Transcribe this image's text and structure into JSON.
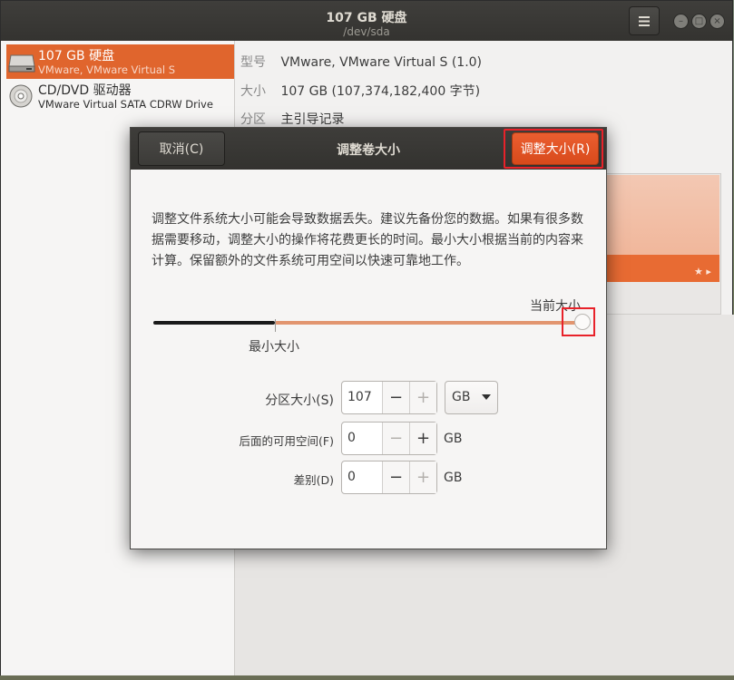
{
  "window": {
    "title": "107 GB 硬盘",
    "subtitle": "/dev/sda"
  },
  "sidebar": {
    "items": [
      {
        "name": "107 GB 硬盘",
        "sub": "VMware, VMware Virtual S",
        "icon": "hard-disk-icon",
        "selected": true
      },
      {
        "name": "CD/DVD 驱动器",
        "sub": "VMware Virtual SATA CDRW Drive",
        "icon": "optical-disc-icon",
        "selected": false
      }
    ]
  },
  "info": {
    "model_key": "型号",
    "model_val": "VMware, VMware Virtual S (1.0)",
    "size_key": "大小",
    "size_val": "107 GB (107,374,182,400 字节)",
    "partition_key": "分区",
    "partition_val": "主引导记录"
  },
  "dialog": {
    "title": "调整卷大小",
    "cancel_label": "取消(C)",
    "resize_label": "调整大小(R)",
    "warning": "调整文件系统大小可能会导致数据丢失。建议先备份您的数据。如果有很多数据需要移动，调整大小的操作将花费更长的时间。最小大小根据当前的内容来计算。保留额外的文件系统可用空间以快速可靠地工作。",
    "current_size_label": "当前大小",
    "min_size_label": "最小大小",
    "slider_level": 1.0,
    "fields": {
      "partition_size_label": "分区大小(S)",
      "partition_size_value": "107",
      "free_after_label": "后面的可用空间(F)",
      "free_after_value": "0",
      "difference_label": "差别(D)",
      "difference_value": "0",
      "unit_selected": "GB",
      "unit": "GB"
    }
  },
  "colors": {
    "accent": "#e0652d",
    "titlebar": "#3a3936"
  }
}
